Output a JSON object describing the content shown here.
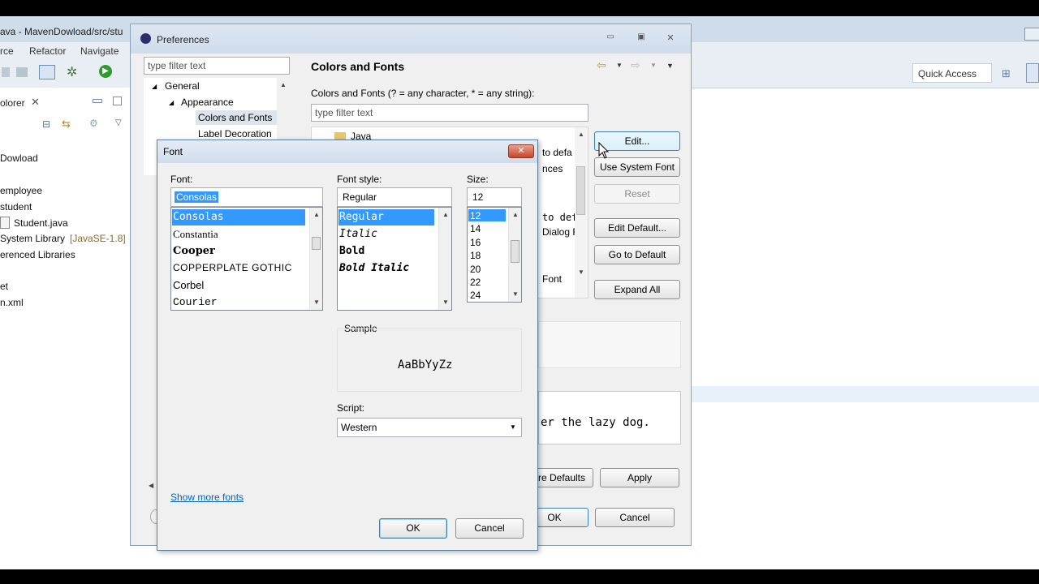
{
  "eclipse": {
    "title": "ava - MavenDowload/src/stu",
    "menu": [
      "rce",
      "Refactor",
      "Navigate"
    ],
    "quick_access": "Quick Access",
    "explorer_title": "olorer",
    "tree": [
      "Dowload",
      "employee",
      "student",
      "Student.java",
      "System Library",
      "[JavaSE-1.8]",
      "erenced Libraries",
      "et",
      "n.xml"
    ]
  },
  "prefs": {
    "title": "Preferences",
    "filter_placeholder": "type filter text",
    "tree": {
      "general": "General",
      "appearance": "Appearance",
      "colors_fonts": "Colors and Fonts",
      "label_decorations": "Label Decoration"
    },
    "page_title": "Colors and Fonts",
    "desc": "Colors and Fonts (? = any character, * = any string):",
    "filter2_placeholder": "type filter text",
    "tree_item_java": "Java",
    "partial": [
      "to defa",
      "nces",
      "to def",
      "Dialog F",
      "Font"
    ],
    "buttons": {
      "edit": "Edit...",
      "use_system_font": "Use System Font",
      "reset": "Reset",
      "edit_default": "Edit Default...",
      "go_to_default": "Go to Default",
      "expand_all": "Expand All",
      "restore_defaults": "re Defaults",
      "apply": "Apply",
      "ok": "OK",
      "cancel": "Cancel"
    },
    "preview_text": "er the lazy dog."
  },
  "font_dialog": {
    "title": "Font",
    "font_label": "Font:",
    "font_value": "Consolas",
    "fonts": [
      "Consolas",
      "Constantia",
      "Cooper",
      "COPPERPLATE GOTHIC",
      "Corbel",
      "Courier"
    ],
    "style_label": "Font style:",
    "style_value": "Regular",
    "styles": [
      "Regular",
      "Italic",
      "Bold",
      "Bold Italic"
    ],
    "size_label": "Size:",
    "size_value": "12",
    "sizes": [
      "12",
      "14",
      "16",
      "18",
      "20",
      "22",
      "24"
    ],
    "sample_label": "Sample",
    "sample_text": "AaBbYyZz",
    "script_label": "Script:",
    "script_value": "Western",
    "show_more": "Show more fonts",
    "ok": "OK",
    "cancel": "Cancel"
  }
}
